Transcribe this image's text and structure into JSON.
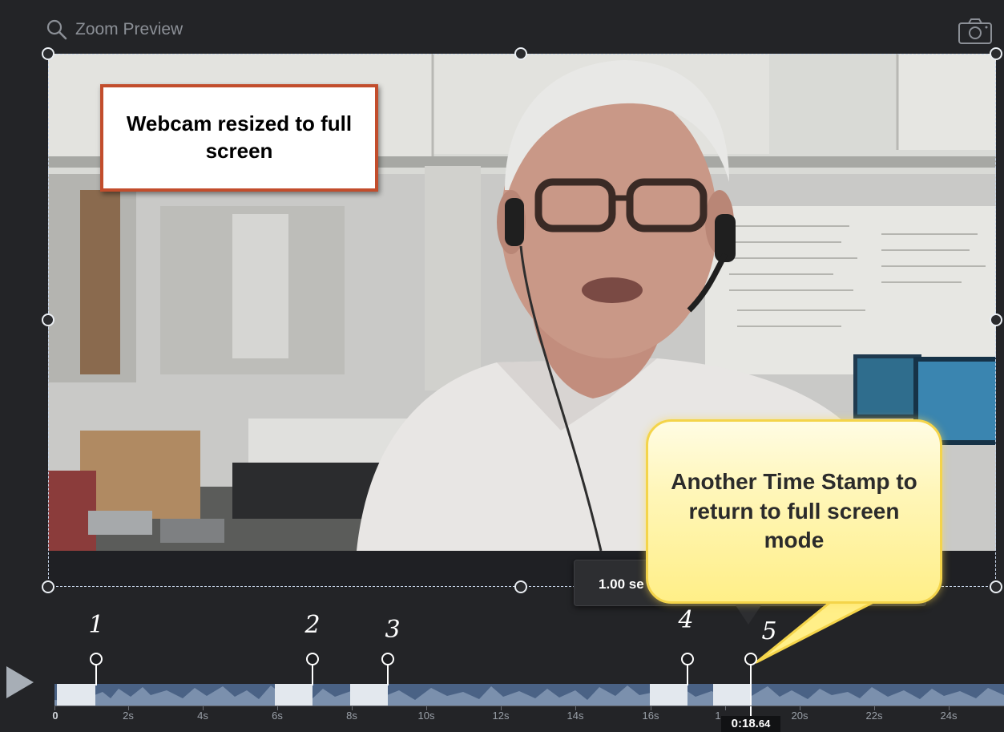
{
  "header": {
    "zoom_preview_label": "Zoom Preview"
  },
  "callouts": {
    "webcam": "Webcam resized to full screen",
    "timestamp": "Another Time Stamp to return to full screen mode"
  },
  "duration_tooltip": {
    "value": "1.00 se"
  },
  "timeline": {
    "markers": [
      "1",
      "2",
      "3",
      "4",
      "5"
    ],
    "ruler_labels": [
      "0",
      "2s",
      "4s",
      "6s",
      "8s",
      "10s",
      "12s",
      "14s",
      "16s",
      "1",
      "20s",
      "22s",
      "24s"
    ],
    "playhead": {
      "main": "0:18.",
      "fraction": "64"
    }
  },
  "colors": {
    "track": "#4a6285",
    "callout_border": "#c24d2c",
    "bubble_fill": "#fff6b8"
  }
}
